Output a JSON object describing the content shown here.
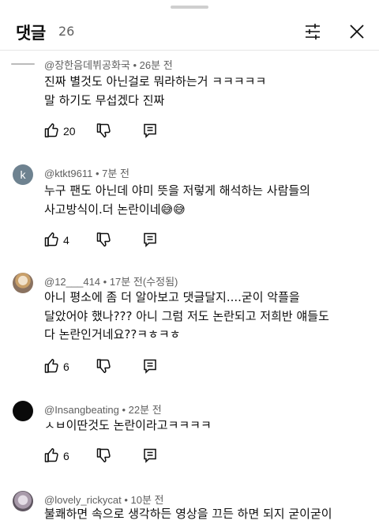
{
  "header": {
    "title": "댓글",
    "count": "26",
    "filter_icon": "sliders-icon",
    "close_icon": "close-icon"
  },
  "comments": [
    {
      "author": "@장한음데뷔공화국",
      "time": "26분 전",
      "text": "진짜 별것도 아닌걸로 뭐라하는거 ㅋㅋㅋㅋㅋ\n말 하기도 무섭겠다 진짜",
      "likes": "20",
      "avatar": "channel-logo"
    },
    {
      "author": "@ktkt9611",
      "time": "7분 전",
      "text": "누구 팬도 아닌데 야미 뜻을 저렇게 해석하는 사람들의\n사고방식이.더  논란이네😅😅",
      "likes": "4",
      "avatar_letter": "k"
    },
    {
      "author": "@12___414",
      "time": "17분 전(수정됨)",
      "text": "아니 평소에 좀 더 알아보고 댓글달지....굳이 악플을\n달았어야 했나??? 아니 그럼 저도 논란되고 저희반 얘들도\n다 논란인거네요??ㅋㅎㅋㅎ",
      "likes": "6",
      "avatar": "profile-photo"
    },
    {
      "author": "@Insangbeating",
      "time": "22분 전",
      "text": "ㅅㅂ이딴것도 논란이라고ㅋㅋㅋㅋ",
      "likes": "6",
      "avatar": "black-circle"
    },
    {
      "author": "@lovely_rickycat",
      "time": "10분 전",
      "text": "불쾌하면 속으로 생각하든 영상을 끄든 하면 되지 굳이굳이",
      "avatar": "profile-photo"
    }
  ],
  "icons": {
    "like": "thumbs-up-icon",
    "dislike": "thumbs-down-icon",
    "reply": "reply-icon"
  }
}
